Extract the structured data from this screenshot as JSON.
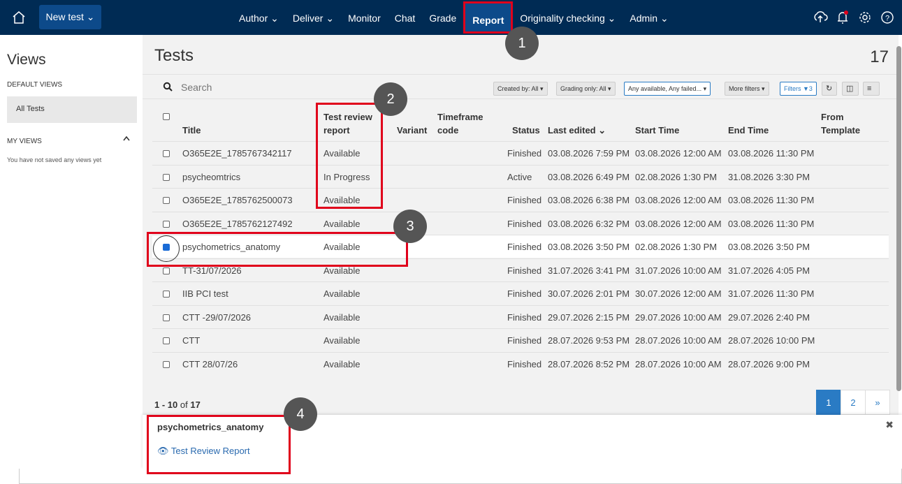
{
  "topbar": {
    "new_test_label": "New test ⌄",
    "nav": [
      "Author ⌄",
      "Deliver ⌄",
      "Monitor",
      "Chat",
      "Grade",
      "Report",
      "Originality checking ⌄",
      "Admin ⌄"
    ],
    "active": "Report",
    "icons": [
      "upload-icon",
      "notification-bell-icon",
      "settings-gear-icon",
      "help-icon"
    ]
  },
  "sidebar": {
    "title": "Views",
    "default_views": "DEFAULT VIEWS",
    "all_tests": "All Tests",
    "my_views": "MY VIEWS",
    "note": "You have not saved any views yet"
  },
  "main": {
    "title": "Tests",
    "count": "17",
    "search_placeholder": "Search",
    "filters": {
      "created_by": "Created by: All ▾",
      "grading_only": "Grading only: All ▾",
      "availability": "Any available, Any failed... ▾",
      "more_filters": "More filters ▾",
      "filters_count": "Filters ▼3"
    }
  },
  "table": {
    "headers": {
      "title": "Title",
      "review_1": "Test review",
      "review_2": "report",
      "variant": "Variant",
      "timeframe_1": "Timeframe",
      "timeframe_2": "code",
      "status": "Status",
      "last_edited": "Last edited ⌄",
      "start": "Start Time",
      "end": "End Time",
      "template_1": "From",
      "template_2": "Template"
    },
    "rows": [
      {
        "title": "O365E2E_1785767342117",
        "review": "Available",
        "status": "Finished",
        "edited": "03.08.2026 7:59 PM",
        "start": "03.08.2026 12:00 AM",
        "end": "03.08.2026 11:30 PM"
      },
      {
        "title": "psycheomtrics",
        "review": "In Progress",
        "status": "Active",
        "edited": "03.08.2026 6:49 PM",
        "start": "02.08.2026 1:30 PM",
        "end": "31.08.2026 3:30 PM"
      },
      {
        "title": "O365E2E_1785762500073",
        "review": "Available",
        "status": "Finished",
        "edited": "03.08.2026 6:38 PM",
        "start": "03.08.2026 12:00 AM",
        "end": "03.08.2026 11:30 PM"
      },
      {
        "title": "O365E2E_1785762127492",
        "review": "Available",
        "status": "Finished",
        "edited": "03.08.2026 6:32 PM",
        "start": "03.08.2026 12:00 AM",
        "end": "03.08.2026 11:30 PM"
      },
      {
        "title": "psychometrics_anatomy",
        "review": "Available",
        "status": "Finished",
        "edited": "03.08.2026 3:50 PM",
        "start": "02.08.2026 1:30 PM",
        "end": "03.08.2026 3:50 PM"
      },
      {
        "title": "TT-31/07/2026",
        "review": "Available",
        "status": "Finished",
        "edited": "31.07.2026 3:41 PM",
        "start": "31.07.2026 10:00 AM",
        "end": "31.07.2026 4:05 PM"
      },
      {
        "title": "IIB PCI test",
        "review": "Available",
        "status": "Finished",
        "edited": "30.07.2026 2:01 PM",
        "start": "30.07.2026 12:00 AM",
        "end": "31.07.2026 11:30 PM"
      },
      {
        "title": "CTT -29/07/2026",
        "review": "Available",
        "status": "Finished",
        "edited": "29.07.2026 2:15 PM",
        "start": "29.07.2026 10:00 AM",
        "end": "29.07.2026 2:40 PM"
      },
      {
        "title": "CTT",
        "review": "Available",
        "status": "Finished",
        "edited": "28.07.2026 9:53 PM",
        "start": "28.07.2026 10:00 AM",
        "end": "28.07.2026 10:00 PM"
      },
      {
        "title": "CTT 28/07/26",
        "review": "Available",
        "status": "Finished",
        "edited": "28.07.2026 8:52 PM",
        "start": "28.07.2026 10:00 AM",
        "end": "28.07.2026 9:00 PM"
      }
    ]
  },
  "pager": {
    "range": "1 - 10",
    "of": "of",
    "total": "17",
    "pages": [
      "1",
      "2",
      "»"
    ]
  },
  "popup": {
    "title": "psychometrics_anatomy",
    "link": "Test Review Report",
    "close": "✖"
  },
  "markers": [
    "1",
    "2",
    "3",
    "4"
  ],
  "colors": {
    "topbar": "#002b54",
    "active_nav": "#0d4a8a",
    "highlight": "#e0001b",
    "link": "#2a6aaf"
  }
}
